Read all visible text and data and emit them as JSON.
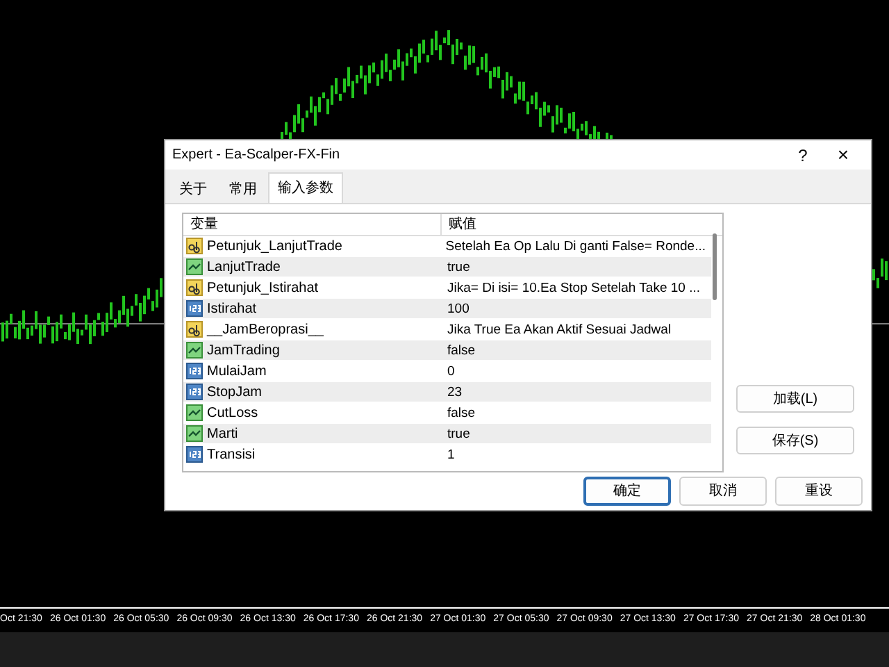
{
  "time_axis": [
    "Oct 21:30",
    "26 Oct 01:30",
    "26 Oct 05:30",
    "26 Oct 09:30",
    "26 Oct 13:30",
    "26 Oct 17:30",
    "26 Oct 21:30",
    "27 Oct 01:30",
    "27 Oct 05:30",
    "27 Oct 09:30",
    "27 Oct 13:30",
    "27 Oct 17:30",
    "27 Oct 21:30",
    "28 Oct 01:30"
  ],
  "dialog": {
    "title": "Expert - Ea-Scalper-FX-Fin",
    "help": "?",
    "close": "×",
    "tabs": [
      {
        "label": "关于",
        "selected": false
      },
      {
        "label": "常用",
        "selected": false
      },
      {
        "label": "输入参数",
        "selected": true
      }
    ],
    "table": {
      "columns": [
        "变量",
        "赋值"
      ],
      "rows": [
        {
          "kind": "string",
          "name": "Petunjuk_LanjutTrade",
          "value": "Setelah Ea Op Lalu Di ganti False= Ronde..."
        },
        {
          "kind": "bool",
          "name": "LanjutTrade",
          "value": "true"
        },
        {
          "kind": "string",
          "name": "Petunjuk_Istirahat",
          "value": "Jika= Di isi= 10.Ea Stop Setelah Take 10 ..."
        },
        {
          "kind": "int",
          "name": "Istirahat",
          "value": "100"
        },
        {
          "kind": "string",
          "name": "__JamBeroprasi__",
          "value": "Jika True Ea Akan Aktif Sesuai Jadwal"
        },
        {
          "kind": "bool",
          "name": "JamTrading",
          "value": "false"
        },
        {
          "kind": "int",
          "name": "MulaiJam",
          "value": "0"
        },
        {
          "kind": "int",
          "name": "StopJam",
          "value": "23"
        },
        {
          "kind": "bool",
          "name": "CutLoss",
          "value": "false"
        },
        {
          "kind": "bool",
          "name": "Marti",
          "value": "true"
        },
        {
          "kind": "int",
          "name": "Transisi",
          "value": "1"
        }
      ]
    },
    "side_buttons": [
      "加载(L)",
      "保存(S)"
    ],
    "buttons": [
      {
        "label": "确定",
        "default": true
      },
      {
        "label": "取消",
        "default": false
      },
      {
        "label": "重设",
        "default": false
      }
    ]
  }
}
